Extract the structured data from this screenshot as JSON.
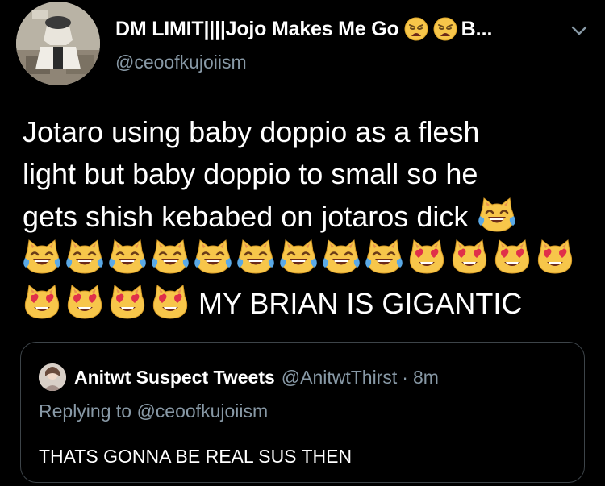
{
  "tweet": {
    "display_name": "DM LIMIT||||Jojo Makes Me Go",
    "name_emojis": [
      "weary-face-emoji",
      "weary-face-emoji"
    ],
    "name_tail": "B...",
    "handle": "@ceoofkujoiism",
    "text_lines": [
      "Jotaro using baby doppio as a flesh",
      "light but baby doppio to small so he",
      "gets shish kebabed on jotaros dick"
    ],
    "emoji_line_1": [
      "cat-tears-of-joy-emoji",
      "cat-tears-of-joy-emoji",
      "cat-tears-of-joy-emoji",
      "cat-tears-of-joy-emoji",
      "cat-tears-of-joy-emoji",
      "cat-tears-of-joy-emoji",
      "cat-tears-of-joy-emoji",
      "cat-tears-of-joy-emoji",
      "cat-tears-of-joy-emoji",
      "heart-eyes-cat-emoji",
      "heart-eyes-cat-emoji",
      "heart-eyes-cat-emoji",
      "heart-eyes-cat-emoji"
    ],
    "emoji_line_2": [
      "heart-eyes-cat-emoji",
      "heart-eyes-cat-emoji",
      "heart-eyes-cat-emoji",
      "heart-eyes-cat-emoji"
    ],
    "closing_text": "MY BRIAN IS GIGANTIC",
    "caret_icon": "chevron-down-icon"
  },
  "quote": {
    "name": "Anitwt Suspect Tweets",
    "handle": "@AnitwtThirst",
    "separator": "·",
    "time": "8m",
    "replying_to": "Replying to @ceoofkujoiism",
    "text": "THATS GONNA BE REAL SUS THEN"
  },
  "colors": {
    "background": "#000000",
    "primary_text": "#ffffff",
    "secondary_text": "#8899a6",
    "quote_border": "#3d4449"
  }
}
